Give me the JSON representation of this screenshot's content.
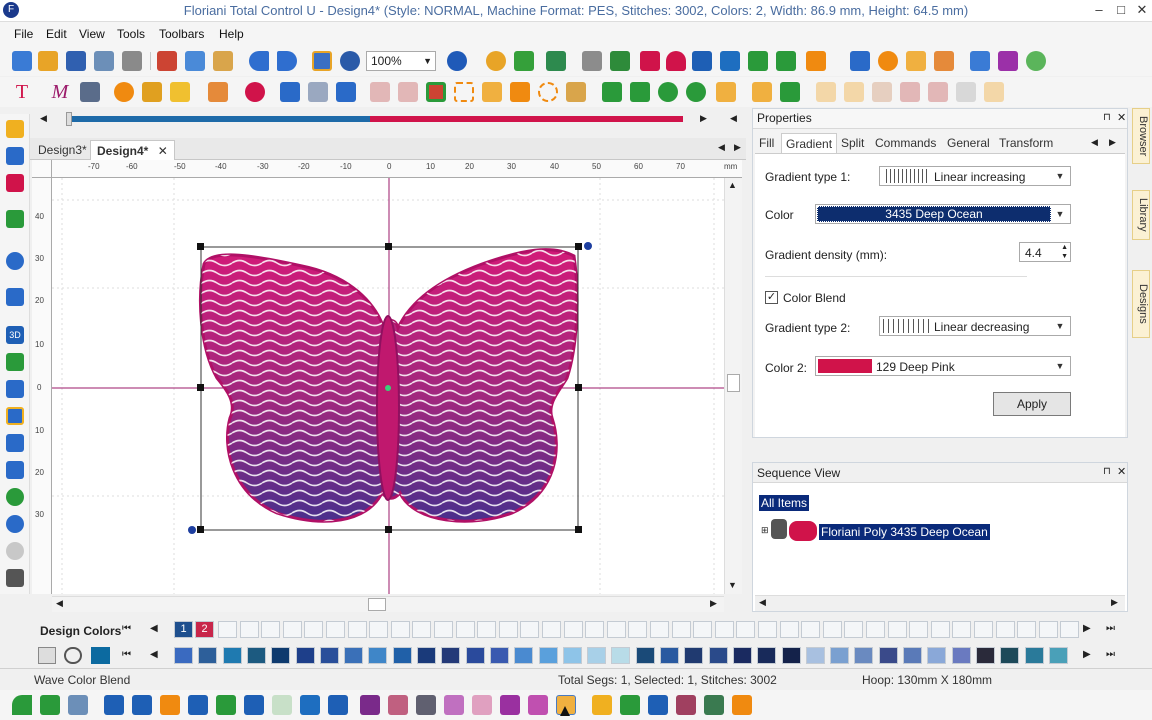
{
  "window": {
    "title": "Floriani Total Control U - Design4* (Style: NORMAL, Machine Format: PES, Stitches: 3002, Colors: 2, Width: 86.9 mm, Height: 64.5 mm)",
    "app_icon": "F"
  },
  "menu": [
    "File",
    "Edit",
    "View",
    "Tools",
    "Toolbars",
    "Help"
  ],
  "toolbar": {
    "zoom": "100%"
  },
  "tabs": [
    "Design3*",
    "Design4*"
  ],
  "ruler_h": [
    "-70",
    "-60",
    "-50",
    "-40",
    "-30",
    "-20",
    "-10",
    "0",
    "10",
    "20",
    "30",
    "40",
    "50",
    "60",
    "70",
    "mm"
  ],
  "ruler_v": [
    "40",
    "30",
    "20",
    "10",
    "0",
    "10",
    "20",
    "30"
  ],
  "properties": {
    "title": "Properties",
    "tabs": [
      "Fill",
      "Gradient",
      "Split",
      "Commands",
      "General",
      "Transform"
    ],
    "gradient_type_1_label": "Gradient type 1:",
    "gradient_type_1": "Linear increasing",
    "color_label": "Color",
    "color": "3435 Deep Ocean",
    "density_label": "Gradient density (mm):",
    "density": "4.4",
    "color_blend_label": "Color Blend",
    "gradient_type_2_label": "Gradient type 2:",
    "gradient_type_2": "Linear decreasing",
    "color2_label": "Color 2:",
    "color2": "129 Deep Pink",
    "apply": "Apply"
  },
  "sequence": {
    "title": "Sequence View",
    "all_items": "All Items",
    "item": "Floriani Poly 3435 Deep Ocean"
  },
  "right_tabs": [
    "Browser",
    "Library",
    "Designs"
  ],
  "design_colors": {
    "label": "Design Colors",
    "chips": [
      "1",
      "2"
    ]
  },
  "status": {
    "left": "Wave Color Blend",
    "mid": "Total Segs: 1, Selected: 1, Stitches: 3002",
    "right": "Hoop: 130mm X 180mm"
  },
  "colors": {
    "deep_ocean": "#0d2d6e",
    "deep_pink": "#d0134a",
    "accent": "#1b4f9b"
  }
}
